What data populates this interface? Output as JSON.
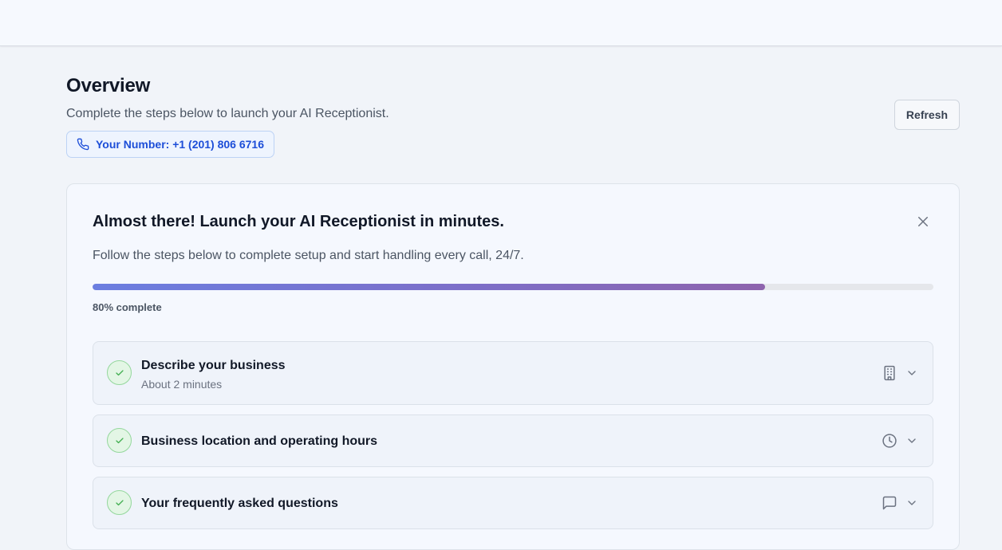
{
  "header": {
    "title": "Overview",
    "subtitle": "Complete the steps below to launch your AI Receptionist.",
    "number_label": "Your Number: +1 (201) 806 6716",
    "refresh_label": "Refresh"
  },
  "card": {
    "title": "Almost there! Launch your AI Receptionist in minutes.",
    "description": "Follow the steps below to complete setup and start handling every call, 24/7.",
    "progress_percent": 80,
    "progress_label": "80% complete"
  },
  "steps": [
    {
      "title": "Describe your business",
      "subtitle": "About 2 minutes",
      "icon": "building-icon",
      "completed": true
    },
    {
      "title": "Business location and operating hours",
      "subtitle": "",
      "icon": "clock-icon",
      "completed": true
    },
    {
      "title": "Your frequently asked questions",
      "subtitle": "",
      "icon": "chat-icon",
      "completed": true
    }
  ],
  "colors": {
    "accent": "#1d4ed8",
    "progress_start": "#6b7ee0",
    "progress_end": "#8e64ad",
    "success": "#3fae4e"
  }
}
